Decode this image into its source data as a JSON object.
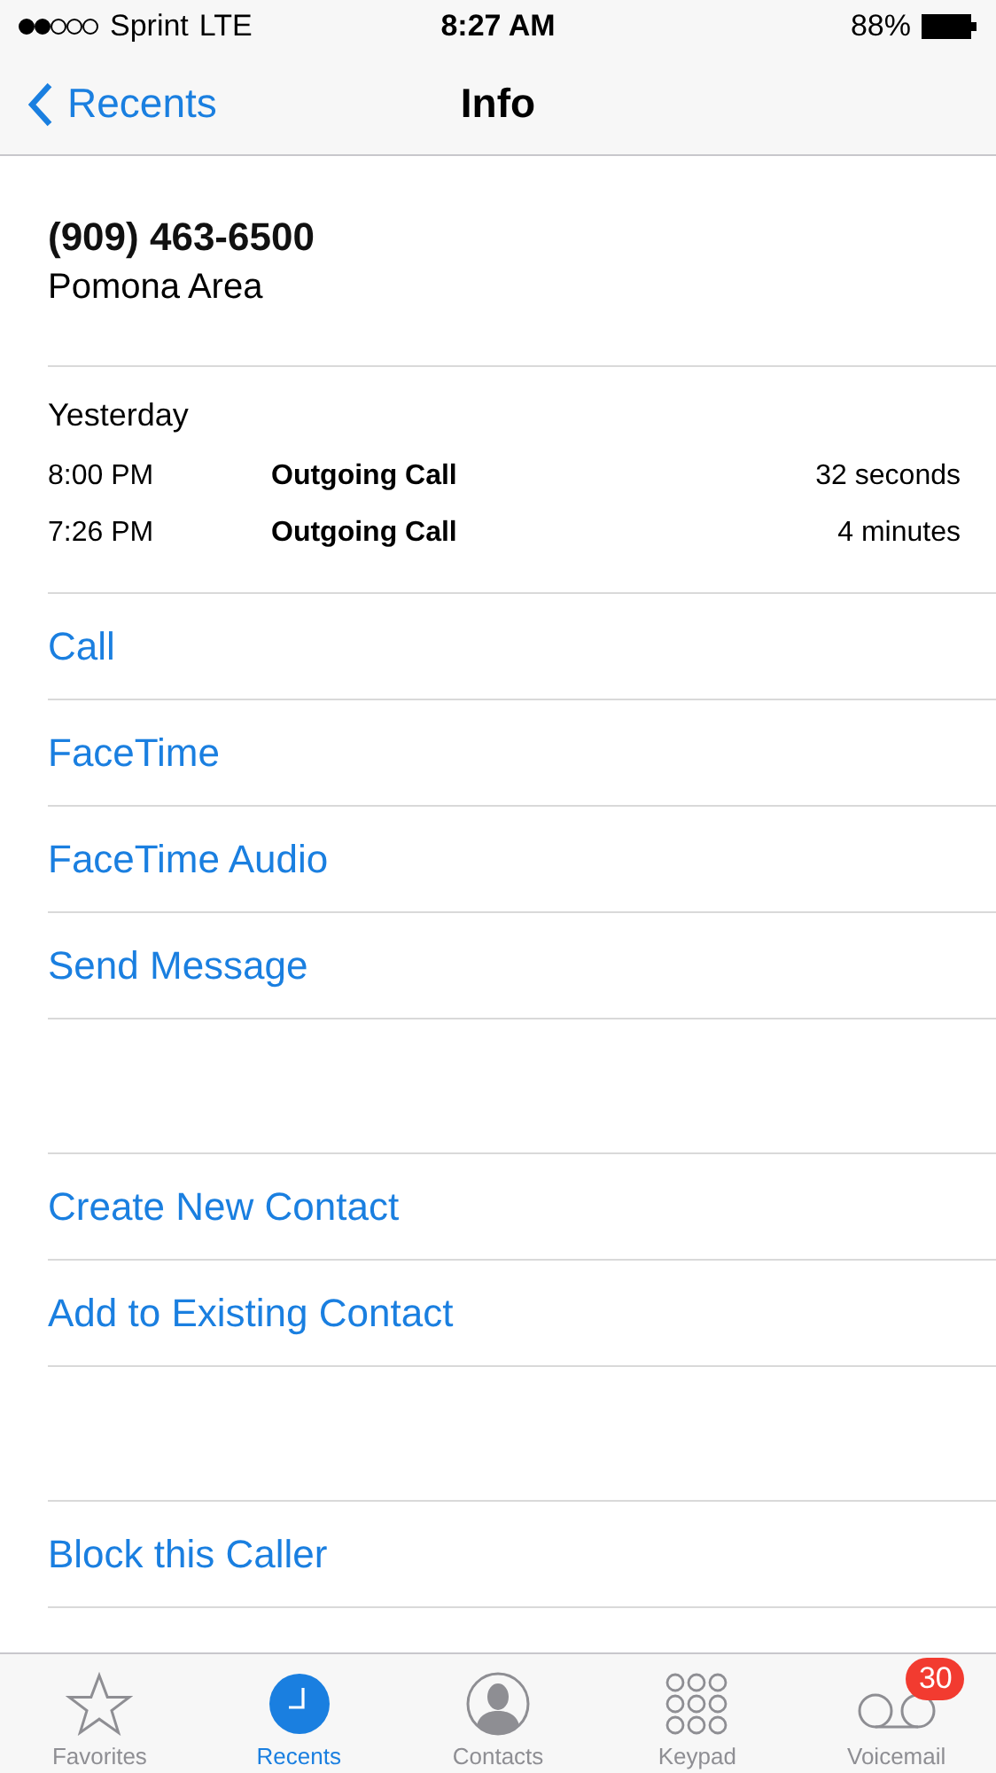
{
  "status_bar": {
    "carrier": "Sprint",
    "network": "LTE",
    "time": "8:27 AM",
    "battery": "88%"
  },
  "nav": {
    "back": "Recents",
    "title": "Info"
  },
  "contact": {
    "number": "(909) 463-6500",
    "location": "Pomona Area"
  },
  "calls": {
    "day": "Yesterday",
    "entries": [
      {
        "time": "8:00 PM",
        "type": "Outgoing Call",
        "duration": "32 seconds"
      },
      {
        "time": "7:26 PM",
        "type": "Outgoing Call",
        "duration": "4 minutes"
      }
    ]
  },
  "action_groups": [
    [
      "Call",
      "FaceTime",
      "FaceTime Audio",
      "Send Message"
    ],
    [
      "Create New Contact",
      "Add to Existing Contact"
    ],
    [
      "Block this Caller"
    ]
  ],
  "tabs": [
    {
      "label": "Favorites",
      "kind": "star",
      "selected": false
    },
    {
      "label": "Recents",
      "kind": "clock",
      "selected": true
    },
    {
      "label": "Contacts",
      "kind": "person",
      "selected": false
    },
    {
      "label": "Keypad",
      "kind": "keypad",
      "selected": false
    },
    {
      "label": "Voicemail",
      "kind": "voicemail",
      "selected": false,
      "badge": "30"
    }
  ]
}
